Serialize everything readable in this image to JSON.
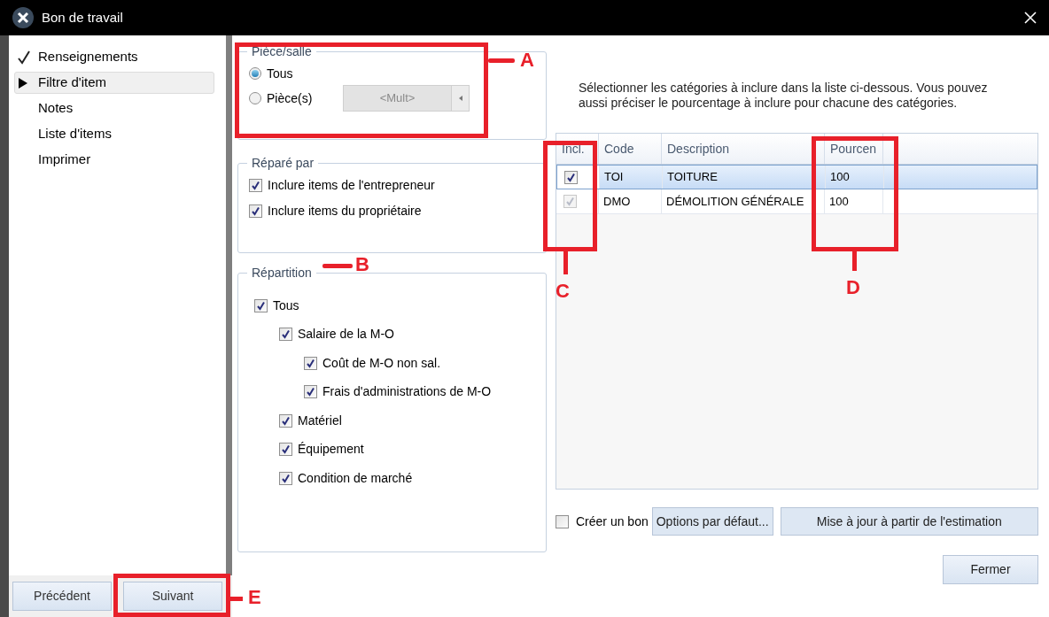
{
  "window": {
    "title": "Bon de travail"
  },
  "sidebar": {
    "items": [
      {
        "label": "Renseignements",
        "done": true,
        "selected": false
      },
      {
        "label": "Filtre d'item",
        "done": false,
        "selected": true
      },
      {
        "label": "Notes",
        "done": false,
        "selected": false
      },
      {
        "label": "Liste d'items",
        "done": false,
        "selected": false
      },
      {
        "label": "Imprimer",
        "done": false,
        "selected": false
      }
    ]
  },
  "nav_buttons": [
    "Précédent",
    "Suivant"
  ],
  "piece_salle": {
    "title": "Pièce/salle",
    "options": [
      {
        "label": "Tous",
        "selected": true
      },
      {
        "label": "Pièce(s)",
        "selected": false
      }
    ],
    "dropdown": {
      "value": "<Mult>",
      "disabled": true
    }
  },
  "repare_par": {
    "title": "Réparé par",
    "items": [
      {
        "label": "Inclure items de l'entrepreneur",
        "checked": true
      },
      {
        "label": "Inclure items du propriétaire",
        "checked": true
      }
    ]
  },
  "repartition": {
    "title": "Répartition",
    "items": [
      {
        "label": "Tous",
        "checked": true,
        "children": [
          {
            "label": "Salaire de la M-O",
            "checked": true,
            "children": [
              {
                "label": "Coût de M-O non sal.",
                "checked": true
              },
              {
                "label": "Frais d'administrations de M-O",
                "checked": true
              }
            ]
          },
          {
            "label": "Matériel",
            "checked": true
          },
          {
            "label": "Équipement",
            "checked": true
          },
          {
            "label": "Condition de marché",
            "checked": true
          }
        ]
      }
    ]
  },
  "instructions": "Sélectionner les catégories à inclure dans la liste ci-dessous.  Vous pouvez aussi préciser le pourcentage à inclure pour chacune des catégories.",
  "table": {
    "columns": [
      "Incl.",
      "Code",
      "Description",
      "Pourcen"
    ],
    "rows": [
      {
        "checked": true,
        "disabled": false,
        "selected": true,
        "code": "TOI",
        "description": "TOITURE",
        "percent": "100"
      },
      {
        "checked": true,
        "disabled": true,
        "selected": false,
        "code": "DMO",
        "description": "DÉMOLITION GÉNÉRALE",
        "percent": "100"
      }
    ]
  },
  "create_voucher": {
    "label": "Créer un bon",
    "checked": false
  },
  "action_buttons": [
    "Options par défaut...",
    "Mise à jour à partir de l'estimation"
  ],
  "close_button": "Fermer",
  "annotations": [
    {
      "label": "A"
    },
    {
      "label": "B"
    },
    {
      "label": "C"
    },
    {
      "label": "D"
    },
    {
      "label": "E"
    }
  ]
}
